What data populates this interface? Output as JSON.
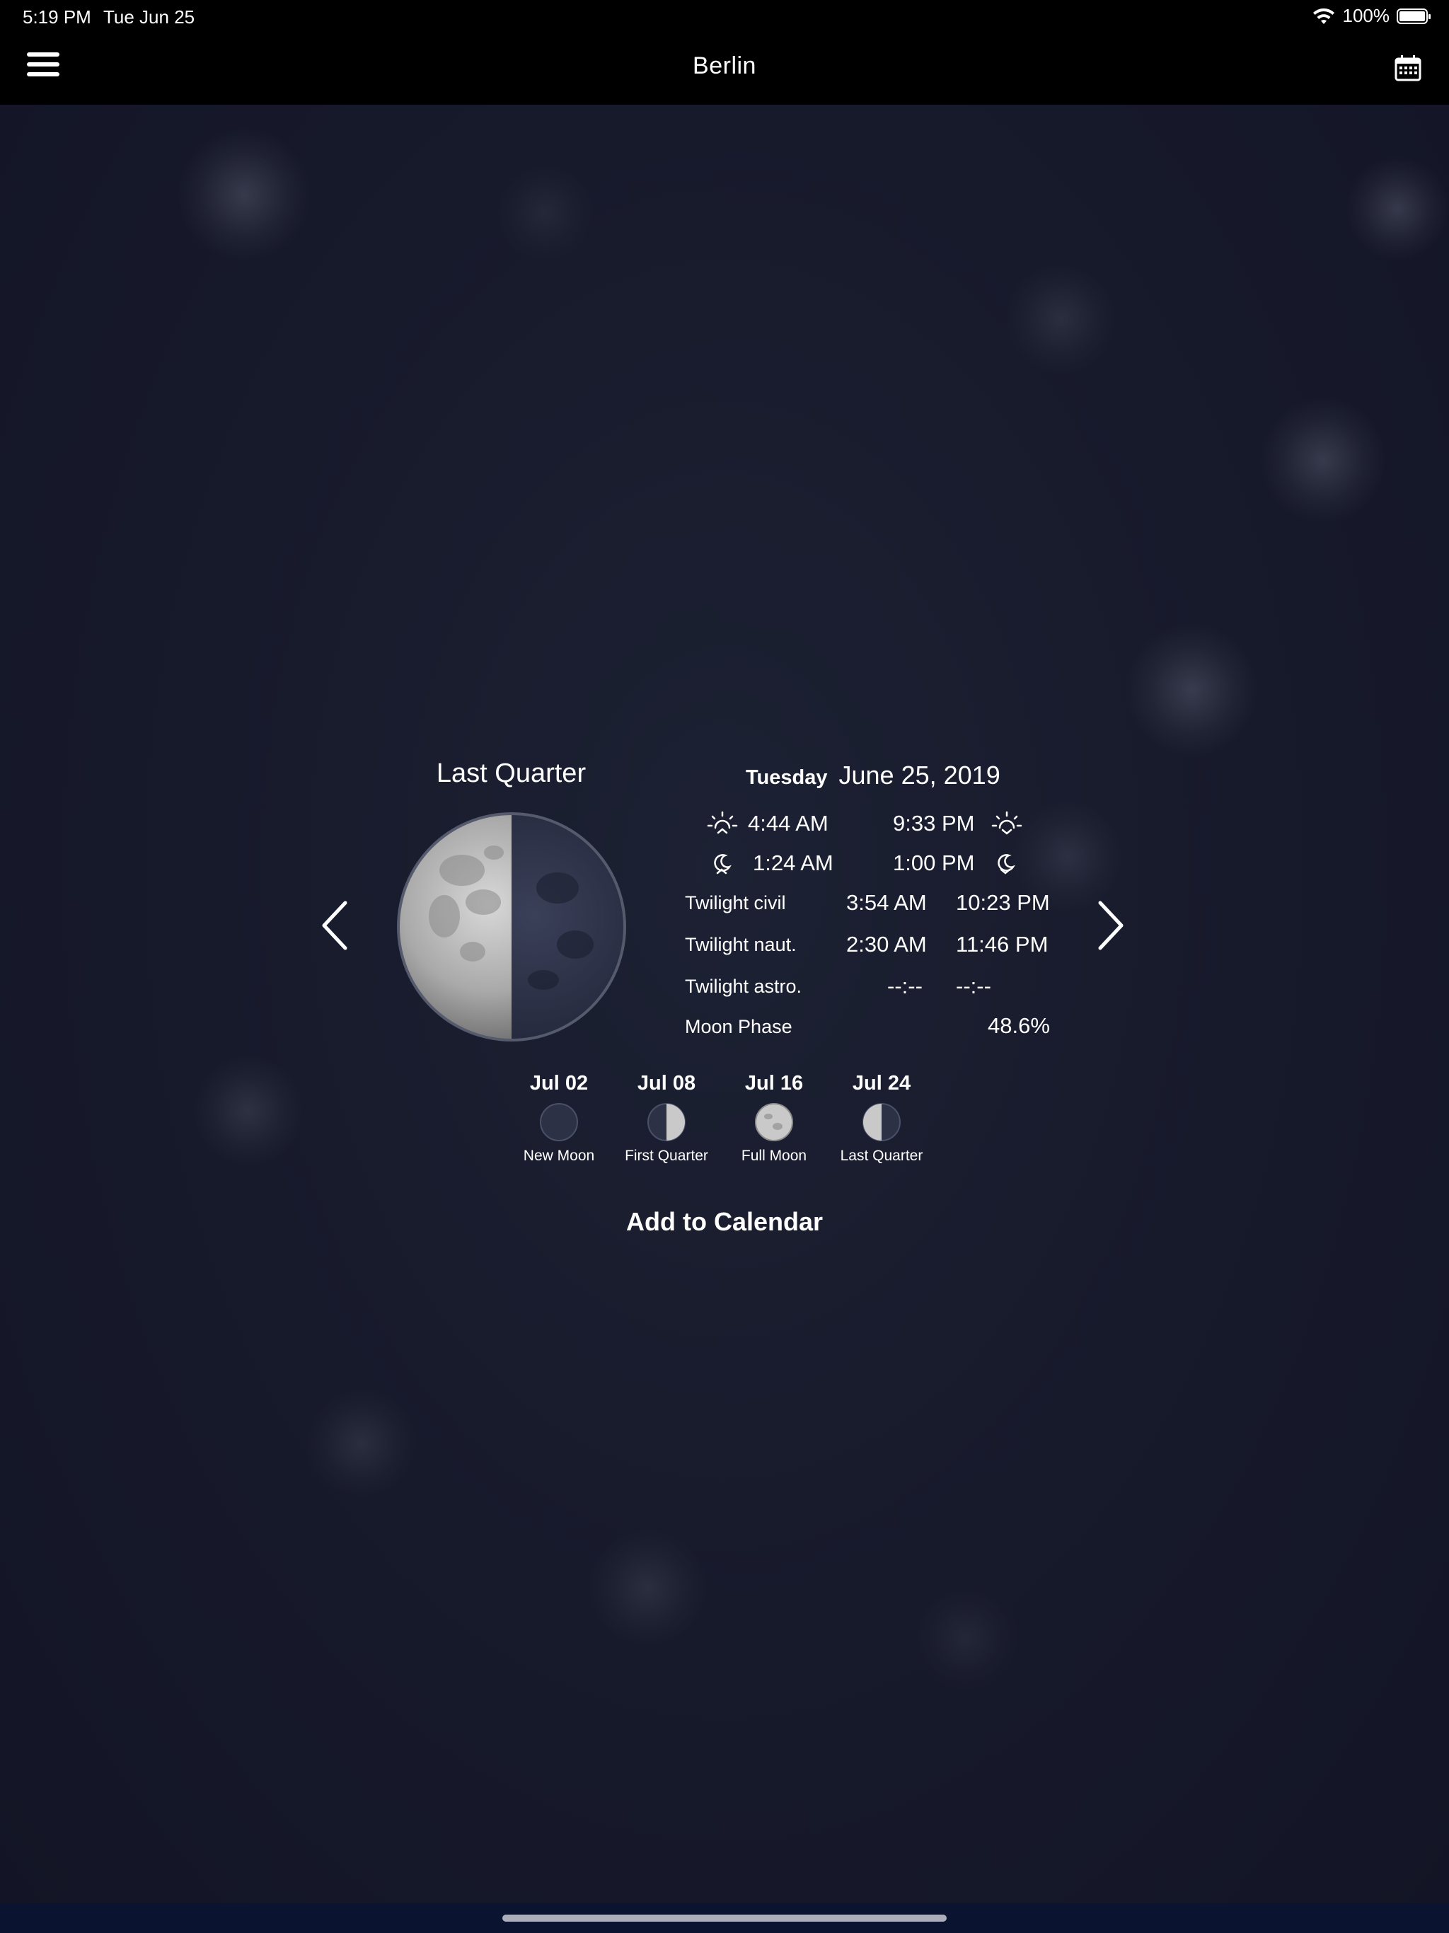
{
  "status_bar": {
    "time": "5:19 PM",
    "date": "Tue Jun 25",
    "battery": "100%"
  },
  "nav": {
    "title": "Berlin",
    "menu_icon": "hamburger-menu-icon",
    "calendar_icon": "calendar-icon"
  },
  "moon": {
    "phase_name": "Last Quarter",
    "weekday": "Tuesday",
    "date": "June 25, 2019",
    "sunrise": "4:44 AM",
    "sunset": "9:33 PM",
    "moonrise": "1:24 AM",
    "moonset": "1:00 PM",
    "phase_label": "Moon Phase",
    "phase_value": "48.6%"
  },
  "twilight": [
    {
      "label": "Twilight civil",
      "start": "3:54 AM",
      "end": "10:23 PM"
    },
    {
      "label": "Twilight naut.",
      "start": "2:30 AM",
      "end": "11:46 PM"
    },
    {
      "label": "Twilight astro.",
      "start": "--:--",
      "end": "--:--"
    }
  ],
  "upcoming": [
    {
      "date": "Jul 02",
      "label": "New Moon"
    },
    {
      "date": "Jul 08",
      "label": "First Quarter"
    },
    {
      "date": "Jul 16",
      "label": "Full Moon"
    },
    {
      "date": "Jul 24",
      "label": "Last Quarter"
    }
  ],
  "actions": {
    "add_to_calendar": "Add to Calendar"
  }
}
